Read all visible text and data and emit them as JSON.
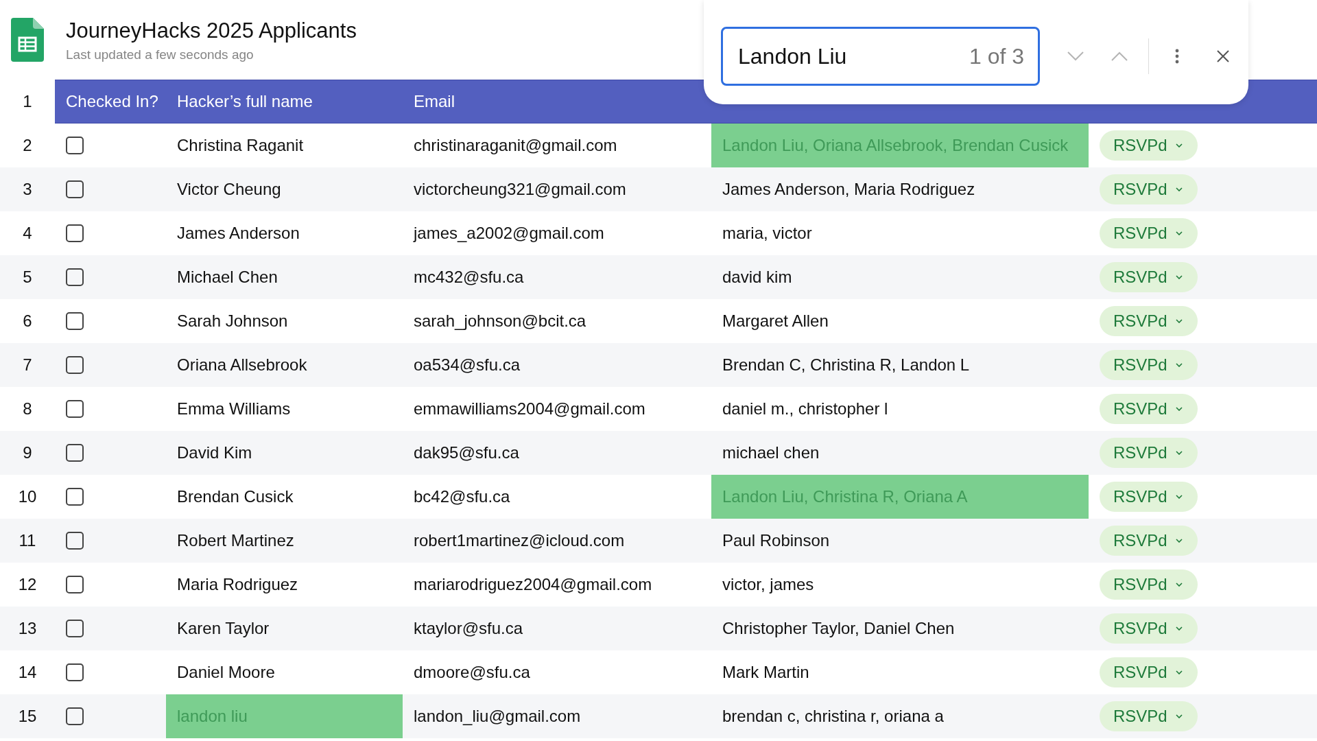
{
  "header": {
    "title": "JourneyHacks 2025 Applicants",
    "subtitle": "Last updated a few seconds ago"
  },
  "find": {
    "value": "Landon Liu",
    "count": "1 of 3"
  },
  "table": {
    "header_row": "1",
    "columns": [
      "Checked In?",
      "Hacker’s full name",
      "Email"
    ],
    "rows": [
      {
        "number": "2",
        "checked": false,
        "name": "Christina Raganit",
        "name_highlighted": false,
        "email": "christinaraganit@gmail.com",
        "team": "Landon Liu, Oriana Allsebrook, Brendan Cusick",
        "team_highlighted": true,
        "status": "RSVPd"
      },
      {
        "number": "3",
        "checked": false,
        "name": "Victor Cheung",
        "name_highlighted": false,
        "email": "victorcheung321@gmail.com",
        "team": "James Anderson, Maria Rodriguez",
        "team_highlighted": false,
        "status": "RSVPd"
      },
      {
        "number": "4",
        "checked": false,
        "name": "James Anderson",
        "name_highlighted": false,
        "email": "james_a2002@gmail.com",
        "team": "maria, victor",
        "team_highlighted": false,
        "status": "RSVPd"
      },
      {
        "number": "5",
        "checked": false,
        "name": "Michael Chen",
        "name_highlighted": false,
        "email": "mc432@sfu.ca",
        "team": "david kim",
        "team_highlighted": false,
        "status": "RSVPd"
      },
      {
        "number": "6",
        "checked": false,
        "name": "Sarah Johnson",
        "name_highlighted": false,
        "email": "sarah_johnson@bcit.ca",
        "team": "Margaret Allen",
        "team_highlighted": false,
        "status": "RSVPd"
      },
      {
        "number": "7",
        "checked": false,
        "name": "Oriana Allsebrook",
        "name_highlighted": false,
        "email": "oa534@sfu.ca",
        "team": "Brendan C, Christina R, Landon L",
        "team_highlighted": false,
        "status": "RSVPd"
      },
      {
        "number": "8",
        "checked": false,
        "name": "Emma Williams",
        "name_highlighted": false,
        "email": "emmawilliams2004@gmail.com",
        "team": "daniel m., christopher l",
        "team_highlighted": false,
        "status": "RSVPd"
      },
      {
        "number": "9",
        "checked": false,
        "name": "David Kim",
        "name_highlighted": false,
        "email": "dak95@sfu.ca",
        "team": "michael chen",
        "team_highlighted": false,
        "status": "RSVPd"
      },
      {
        "number": "10",
        "checked": false,
        "name": "Brendan Cusick",
        "name_highlighted": false,
        "email": "bc42@sfu.ca",
        "team": "Landon Liu, Christina R, Oriana A",
        "team_highlighted": true,
        "status": "RSVPd"
      },
      {
        "number": "11",
        "checked": false,
        "name": "Robert Martinez",
        "name_highlighted": false,
        "email": "robert1martinez@icloud.com",
        "team": "Paul Robinson",
        "team_highlighted": false,
        "status": "RSVPd"
      },
      {
        "number": "12",
        "checked": false,
        "name": "Maria Rodriguez",
        "name_highlighted": false,
        "email": "mariarodriguez2004@gmail.com",
        "team": "victor, james",
        "team_highlighted": false,
        "status": "RSVPd"
      },
      {
        "number": "13",
        "checked": false,
        "name": "Karen Taylor",
        "name_highlighted": false,
        "email": "ktaylor@sfu.ca",
        "team": "Christopher Taylor, Daniel Chen",
        "team_highlighted": false,
        "status": "RSVPd"
      },
      {
        "number": "14",
        "checked": false,
        "name": "Daniel Moore",
        "name_highlighted": false,
        "email": "dmoore@sfu.ca",
        "team": "Mark Martin",
        "team_highlighted": false,
        "status": "RSVPd"
      },
      {
        "number": "15",
        "checked": false,
        "name": "landon liu",
        "name_highlighted": true,
        "email": "landon_liu@gmail.com",
        "team": "brendan c, christina r, oriana a",
        "team_highlighted": false,
        "status": "RSVPd"
      }
    ]
  }
}
